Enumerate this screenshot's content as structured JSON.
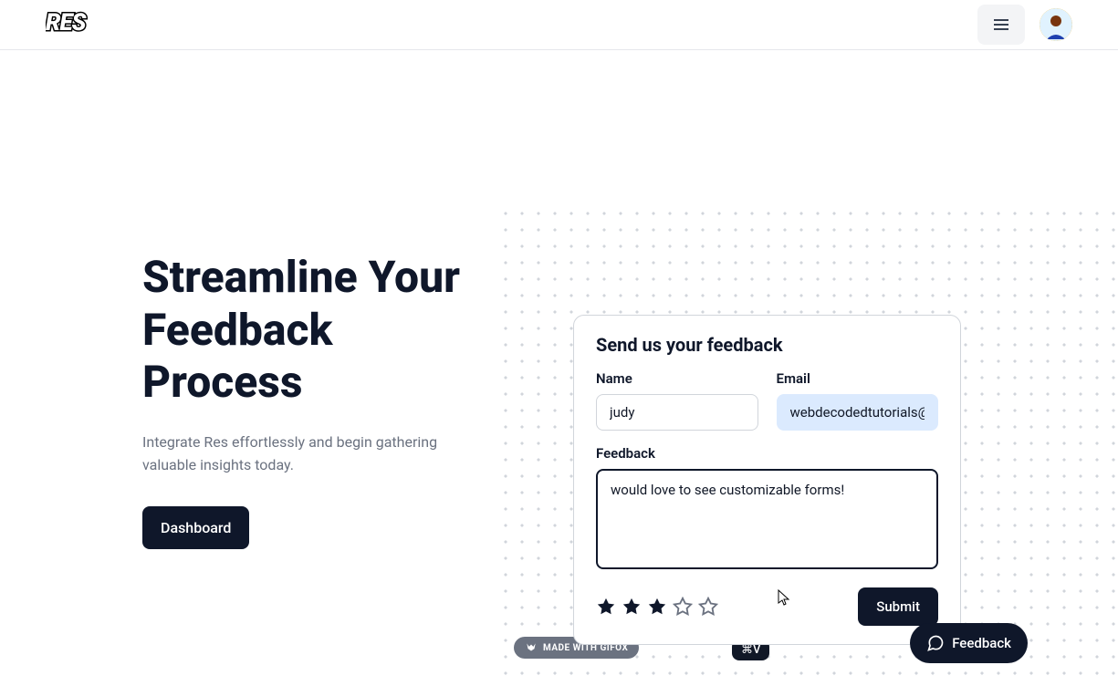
{
  "header": {
    "logo": "RES"
  },
  "hero": {
    "title": "Streamline Your Feedback Process",
    "subtitle": "Integrate Res effortlessly and begin gathering valuable insights today.",
    "dashboard_label": "Dashboard"
  },
  "feedback_card": {
    "title": "Send us your feedback",
    "name_label": "Name",
    "name_value": "judy",
    "email_label": "Email",
    "email_value": "webdecodedtutorials@g",
    "feedback_label": "Feedback",
    "feedback_value": "would love to see customizable forms!",
    "rating": 3,
    "max_rating": 5,
    "submit_label": "Submit"
  },
  "badges": {
    "gifox": "MADE WITH GIFOX",
    "key1": "⇥",
    "key2": "⌘V"
  },
  "feedback_pill": {
    "label": "Feedback"
  }
}
